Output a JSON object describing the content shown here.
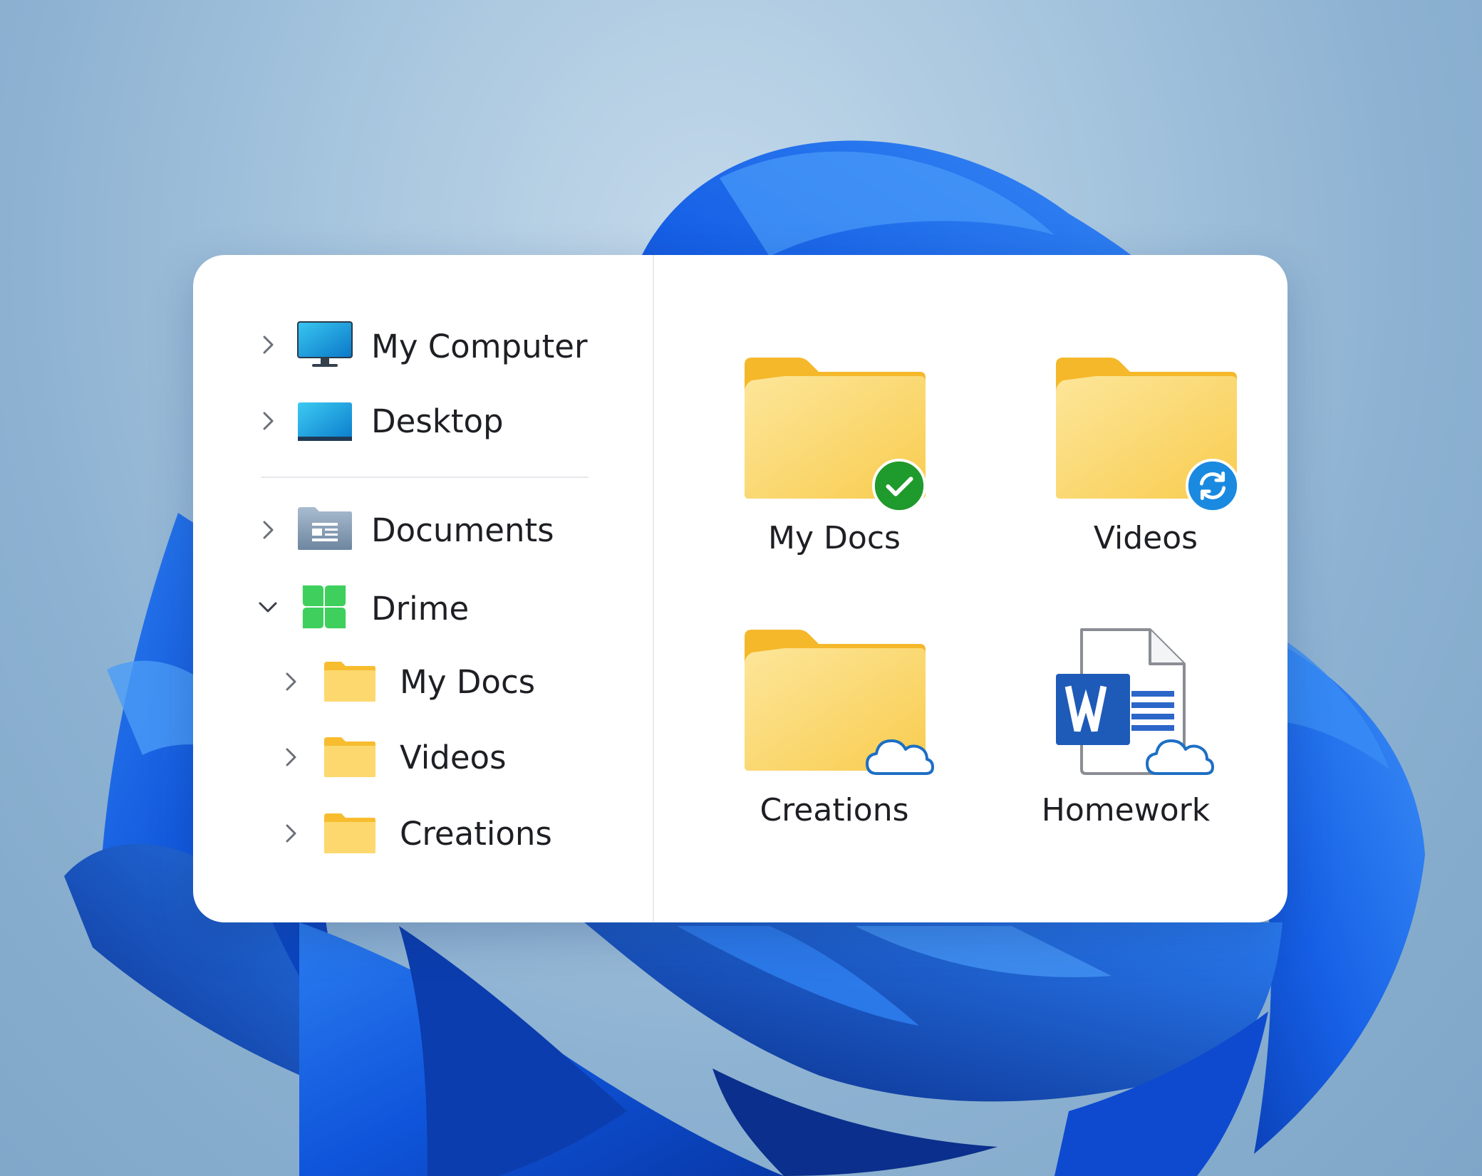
{
  "sidebar": {
    "items": [
      {
        "label": "My Computer",
        "icon": "monitor-icon",
        "expanded": false
      },
      {
        "label": "Desktop",
        "icon": "desktop-icon",
        "expanded": false
      },
      {
        "label": "Documents",
        "icon": "documents-folder-icon",
        "expanded": false
      },
      {
        "label": "Drime",
        "icon": "drime-logo-icon",
        "expanded": true
      },
      {
        "label": "My Docs",
        "icon": "folder-icon",
        "expanded": false,
        "child": true
      },
      {
        "label": "Videos",
        "icon": "folder-icon",
        "expanded": false,
        "child": true
      },
      {
        "label": "Creations",
        "icon": "folder-icon",
        "expanded": false,
        "child": true
      }
    ]
  },
  "content": {
    "tiles": [
      {
        "label": "My Docs",
        "icon": "folder-icon",
        "status": "synced-check-icon"
      },
      {
        "label": "Videos",
        "icon": "folder-icon",
        "status": "syncing-icon"
      },
      {
        "label": "Creations",
        "icon": "folder-icon",
        "status": "cloud-icon"
      },
      {
        "label": "Homework",
        "icon": "word-document-icon",
        "status": "cloud-icon"
      }
    ]
  },
  "colors": {
    "folder_yellow": "#fcd86e",
    "sync_green": "#1f9a2c",
    "sync_blue": "#1a8ae0",
    "word_blue": "#1e5bb8",
    "drime_green": "#3ecf5c"
  }
}
